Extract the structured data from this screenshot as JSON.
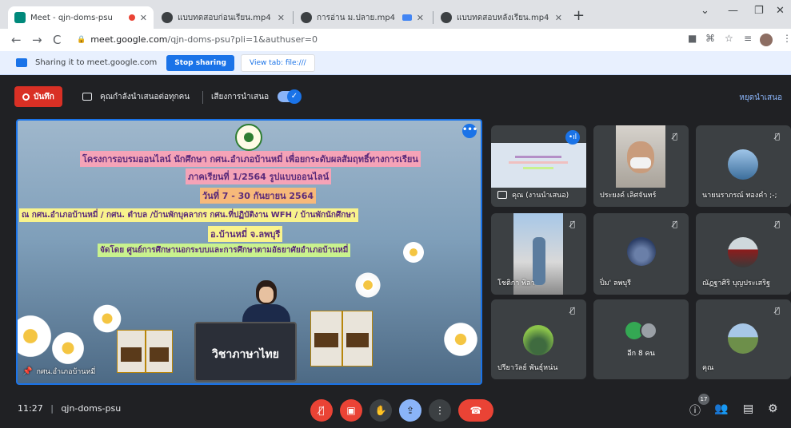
{
  "browser": {
    "tabs": [
      {
        "label": "Meet - qjn-doms-psu",
        "active": true
      },
      {
        "label": "แบบทดสอบก่อนเรียน.mp4",
        "active": false
      },
      {
        "label": "การอ่าน ม.ปลาย.mp4",
        "active": false
      },
      {
        "label": "แบบทดสอบหลังเรียน.mp4",
        "active": false
      }
    ],
    "url_host": "meet.google.com",
    "url_path": "/qjn-doms-psu?pli=1&authuser=0"
  },
  "sharing_bar": {
    "text": "Sharing it to meet.google.com",
    "stop_label": "Stop sharing",
    "view_label": "View tab: file:///"
  },
  "meet_top": {
    "record_label": "บันทึก",
    "presenting_text": "คุณกำลังนำเสนอต่อทุกคน",
    "audio_text": "เสียงการนำเสนอ",
    "stop_presenting": "หยุดนำเสนอ"
  },
  "stage": {
    "lines": [
      "โครงการอบรมออนไลน์  นักศึกษา กศน.อำเภอบ้านหมี่  เพื่อยกระดับผลสัมฤทธิ์ทางการเรียน",
      "ภาคเรียนที่ 1/2564  รูปแบบออนไลน์",
      "วันที่ 7 - 30 กันยายน 2564",
      "ณ กศน.อำเภอบ้านหมี่ / กศน. ตำบล /บ้านพักบุคลากร กศน.ที่ปฏิบัติงาน WFH / บ้านพักนักศึกษา",
      "อ.บ้านหมี่  จ.ลพบุรี",
      "จัดโดย  ศูนย์การศึกษานอกระบบและการศึกษาตามอัธยาศัยอำเภอบ้านหมี่"
    ],
    "laptop_text": "วิชาภาษาไทย",
    "presenter_name": "กศน.อำเภอบ้านหมี่"
  },
  "participants": [
    {
      "name": "คุณ (งานนำเสนอ)"
    },
    {
      "name": "ประยงค์ เลิศจันทร์"
    },
    {
      "name": "นายนราภรณ์ ทองคำ ;-;"
    },
    {
      "name": "โชติกา พิลา"
    },
    {
      "name": "ปิ่ม' ลพบุรี"
    },
    {
      "name": "ณัฏฐาศิริ บุญประเสริฐ"
    },
    {
      "name": "ปรียาวัลย์ พันธุ์หน่น"
    },
    {
      "name": "อีก 8 คน"
    },
    {
      "name": "คุณ"
    }
  ],
  "bottom": {
    "time": "11:27",
    "meeting_code": "qjn-doms-psu",
    "participant_count": "17"
  },
  "colors": {
    "accent": "#1a73e8",
    "danger": "#d93025",
    "background": "#202124"
  }
}
